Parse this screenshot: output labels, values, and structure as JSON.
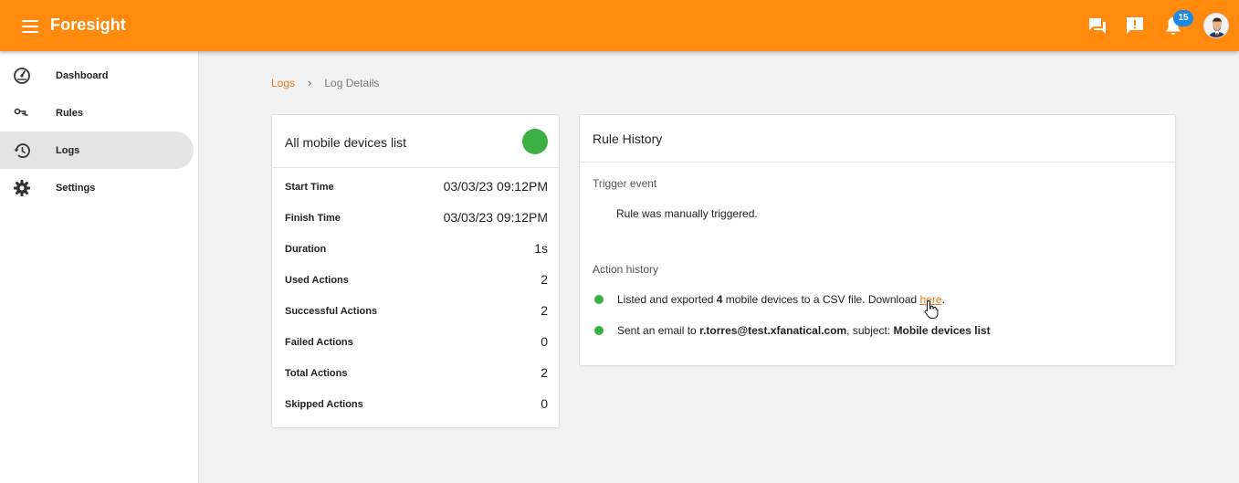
{
  "app": {
    "title": "Foresight",
    "notification_count": "15",
    "colors": {
      "brand": "#ff8a0e",
      "success": "#3cb043",
      "link": "#e8781a",
      "badge": "#1e88e5"
    }
  },
  "topbar": {
    "icons": [
      "menu-icon",
      "chat-icon",
      "feedback-icon",
      "bell-icon",
      "avatar"
    ]
  },
  "sidebar": {
    "items": [
      {
        "label": "Dashboard",
        "icon": "dashboard-icon"
      },
      {
        "label": "Rules",
        "icon": "rules-icon"
      },
      {
        "label": "Logs",
        "icon": "history-icon",
        "active": true
      },
      {
        "label": "Settings",
        "icon": "gear-icon"
      }
    ]
  },
  "breadcrumb": {
    "link": "Logs",
    "separator": "›",
    "current": "Log Details"
  },
  "summary": {
    "title": "All mobile devices list",
    "rows": [
      {
        "label": "Start Time",
        "value": "03/03/23 09:12PM"
      },
      {
        "label": "Finish Time",
        "value": "03/03/23 09:12PM"
      },
      {
        "label": "Duration",
        "value": "1s"
      },
      {
        "label": "Used Actions",
        "value": "2"
      },
      {
        "label": "Successful Actions",
        "value": "2"
      },
      {
        "label": "Failed Actions",
        "value": "0"
      },
      {
        "label": "Total Actions",
        "value": "2"
      },
      {
        "label": "Skipped Actions",
        "value": "0"
      }
    ]
  },
  "history": {
    "title": "Rule History",
    "trigger_label": "Trigger event",
    "trigger_text": "Rule was manually triggered.",
    "action_label": "Action history",
    "actions": [
      {
        "prefix": "Listed and exported ",
        "count": "4",
        "mid": " mobile devices to a CSV file. Download ",
        "link": "here",
        "suffix": "."
      },
      {
        "prefix": "Sent an email to ",
        "email": "r.torres@test.xfanatical.com",
        "mid": ", subject: ",
        "subject": "Mobile devices list"
      }
    ]
  }
}
